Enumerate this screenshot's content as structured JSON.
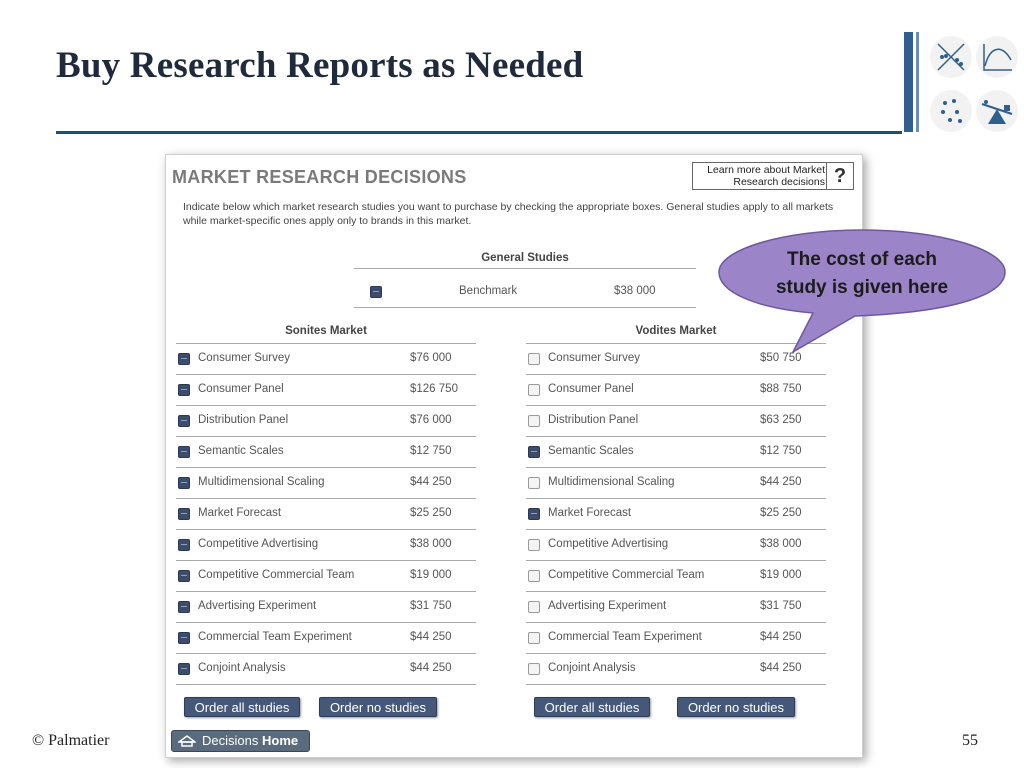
{
  "slide": {
    "title": "Buy Research Reports as Needed",
    "footer_left": "© Palmatier",
    "page_number": "55"
  },
  "panel": {
    "title": "MARKET RESEARCH DECISIONS",
    "help_text": "Learn more about Market\nResearch decisions",
    "help_symbol": "?",
    "instructions": "Indicate below which market research studies you want to purchase by checking the appropriate boxes. General studies apply to all markets while market-specific ones apply only to brands in this market.",
    "general_studies": {
      "header": "General Studies",
      "rows": [
        {
          "name": "Benchmark",
          "price": "$38 000",
          "checked": true
        }
      ]
    },
    "markets": [
      {
        "header": "Sonites Market",
        "rows": [
          {
            "name": "Consumer Survey",
            "price": "$76 000",
            "checked": true
          },
          {
            "name": "Consumer Panel",
            "price": "$126 750",
            "checked": true
          },
          {
            "name": "Distribution Panel",
            "price": "$76 000",
            "checked": true
          },
          {
            "name": "Semantic Scales",
            "price": "$12 750",
            "checked": true
          },
          {
            "name": "Multidimensional Scaling",
            "price": "$44 250",
            "checked": true
          },
          {
            "name": "Market Forecast",
            "price": "$25 250",
            "checked": true
          },
          {
            "name": "Competitive Advertising",
            "price": "$38 000",
            "checked": true
          },
          {
            "name": "Competitive Commercial Team",
            "price": "$19 000",
            "checked": true
          },
          {
            "name": "Advertising Experiment",
            "price": "$31 750",
            "checked": true
          },
          {
            "name": "Commercial Team Experiment",
            "price": "$44 250",
            "checked": true
          },
          {
            "name": "Conjoint Analysis",
            "price": "$44 250",
            "checked": true
          }
        ],
        "order_all_label": "Order all studies",
        "order_none_label": "Order no studies"
      },
      {
        "header": "Vodites Market",
        "rows": [
          {
            "name": "Consumer Survey",
            "price": "$50 750",
            "checked": false
          },
          {
            "name": "Consumer Panel",
            "price": "$88 750",
            "checked": false
          },
          {
            "name": "Distribution Panel",
            "price": "$63 250",
            "checked": false
          },
          {
            "name": "Semantic Scales",
            "price": "$12 750",
            "checked": true
          },
          {
            "name": "Multidimensional Scaling",
            "price": "$44 250",
            "checked": false
          },
          {
            "name": "Market Forecast",
            "price": "$25 250",
            "checked": true
          },
          {
            "name": "Competitive Advertising",
            "price": "$38 000",
            "checked": false
          },
          {
            "name": "Competitive Commercial Team",
            "price": "$19 000",
            "checked": false
          },
          {
            "name": "Advertising Experiment",
            "price": "$31 750",
            "checked": false
          },
          {
            "name": "Commercial Team Experiment",
            "price": "$44 250",
            "checked": false
          },
          {
            "name": "Conjoint Analysis",
            "price": "$44 250",
            "checked": false
          }
        ],
        "order_all_label": "Order all studies",
        "order_none_label": "Order no studies"
      }
    ]
  },
  "nav": {
    "decisions_label": "Decisions",
    "home_label": "Home",
    "icon": "home-icon"
  },
  "callout": {
    "text": "The cost of each\nstudy is given here",
    "fill": "#9b84c8",
    "stroke": "#6d58a0"
  },
  "colors": {
    "title_rule": "#1f4e79",
    "button": "#45587a",
    "checkbox_checked": "#3b4d6b"
  },
  "icons": [
    "scatter-icon",
    "curve-chart-icon",
    "cluster-icon",
    "seesaw-icon"
  ]
}
